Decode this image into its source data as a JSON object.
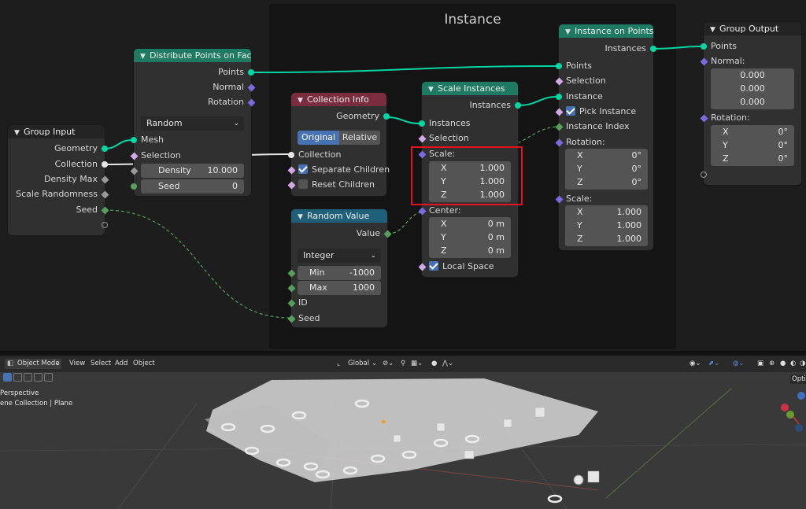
{
  "frame": {
    "title": "Instance"
  },
  "group_input": {
    "title": "Group Input",
    "outputs": [
      "Geometry",
      "Collection",
      "Density Max",
      "Scale Randomness",
      "Seed"
    ]
  },
  "distribute": {
    "title": "Distribute Points on Faces",
    "outputs": [
      "Points",
      "Normal",
      "Rotation"
    ],
    "mode": "Random",
    "inputs": [
      "Mesh",
      "Selection"
    ],
    "density_label": "Density",
    "density_value": "10.000",
    "seed_label": "Seed",
    "seed_value": "0"
  },
  "collection_info": {
    "title": "Collection Info",
    "output": "Geometry",
    "btn_original": "Original",
    "btn_relative": "Relative",
    "collection": "Collection",
    "separate_children": "Separate Children",
    "reset_children": "Reset Children"
  },
  "random_value": {
    "title": "Random Value",
    "output": "Value",
    "type": "Integer",
    "min_label": "Min",
    "min_value": "-1000",
    "max_label": "Max",
    "max_value": "1000",
    "id": "ID",
    "seed": "Seed"
  },
  "scale_instances": {
    "title": "Scale Instances",
    "output": "Instances",
    "inputs": [
      "Instances",
      "Selection"
    ],
    "scale_label": "Scale:",
    "scale": [
      {
        "axis": "X",
        "value": "1.000"
      },
      {
        "axis": "Y",
        "value": "1.000"
      },
      {
        "axis": "Z",
        "value": "1.000"
      }
    ],
    "center_label": "Center:",
    "center": [
      {
        "axis": "X",
        "value": "0 m"
      },
      {
        "axis": "Y",
        "value": "0 m"
      },
      {
        "axis": "Z",
        "value": "0 m"
      }
    ],
    "local_space": "Local Space"
  },
  "instance_on_points": {
    "title": "Instance on Points",
    "output": "Instances",
    "inputs": [
      "Points",
      "Selection",
      "Instance"
    ],
    "pick_instance": "Pick Instance",
    "instance_index": "Instance Index",
    "rotation_label": "Rotation:",
    "rotation": [
      {
        "axis": "X",
        "value": "0°"
      },
      {
        "axis": "Y",
        "value": "0°"
      },
      {
        "axis": "Z",
        "value": "0°"
      }
    ],
    "scale_label": "Scale:",
    "scale": [
      {
        "axis": "X",
        "value": "1.000"
      },
      {
        "axis": "Y",
        "value": "1.000"
      },
      {
        "axis": "Z",
        "value": "1.000"
      }
    ]
  },
  "group_output": {
    "title": "Group Output",
    "points": "Points",
    "normal_label": "Normal:",
    "normal": [
      "0.000",
      "0.000",
      "0.000"
    ],
    "rotation_label": "Rotation:",
    "rotation": [
      {
        "axis": "X",
        "value": "0°"
      },
      {
        "axis": "Y",
        "value": "0°"
      },
      {
        "axis": "Z",
        "value": "0°"
      }
    ]
  },
  "viewport": {
    "mode": "Object Mode",
    "menu": [
      "View",
      "Select",
      "Add",
      "Object"
    ],
    "orientation": "Global",
    "view_label": "Perspective",
    "collection_label": "ene Collection | Plane",
    "options": "Optio"
  },
  "colors": {
    "socket_geometry": "#00d6a3",
    "socket_vector": "#7a6ae0",
    "socket_bool": "#d3a8e6",
    "socket_int": "#55a05a",
    "highlight": "#e3141e"
  }
}
